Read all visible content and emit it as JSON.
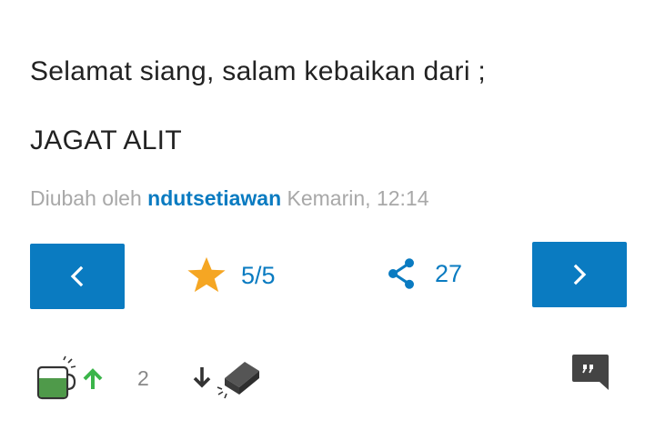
{
  "post": {
    "greeting": "Selamat siang, salam kebaikan dari ;",
    "signature": "JAGAT ALIT",
    "edited_prefix": "Diubah oleh",
    "author": "ndutsetiawan",
    "edited_time": "Kemarin, 12:14"
  },
  "stats": {
    "rating": "5/5",
    "shares": "27",
    "upvotes": "2"
  },
  "icons": {
    "prev": "chevron-left-icon",
    "next": "chevron-right-icon",
    "rating": "star-icon",
    "share": "share-icon",
    "upvote": "cendol-cup-up-icon",
    "downvote": "brick-down-icon",
    "comment": "quote-comment-icon"
  },
  "colors": {
    "accent": "#0a7bc1",
    "star": "#f5a623",
    "upvote_green": "#3bb54a",
    "text": "#222222",
    "muted": "#a8a8a8",
    "icon_dark": "#444444"
  }
}
